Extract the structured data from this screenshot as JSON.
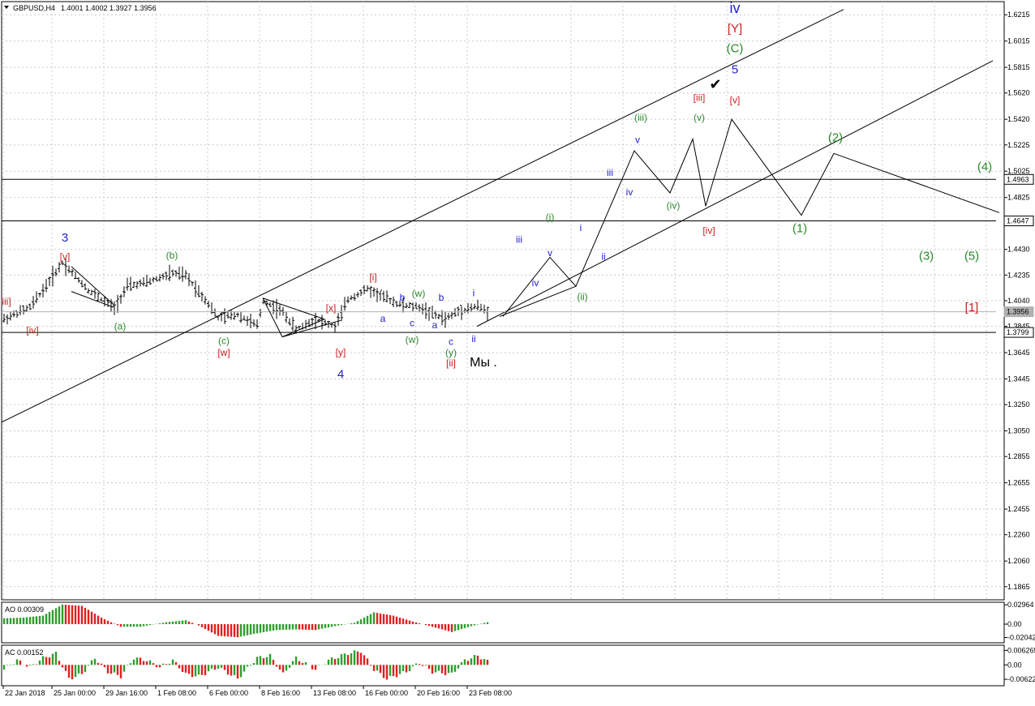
{
  "header": {
    "symbol": "GBPUSD,H4",
    "quote": "1.4001 1.4002 1.3927 1.3956"
  },
  "chart_data": {
    "type": "ohlc",
    "symbol": "GBPUSD",
    "timeframe": "H4",
    "price_axis": {
      "ylim": [
        1.1765,
        1.6315
      ],
      "ticks": [
        "1.6215",
        "1.6015",
        "1.5815",
        "1.5620",
        "1.5420",
        "1.5225",
        "1.5025",
        "1.4825",
        "1.4430",
        "1.4235",
        "1.4040",
        "1.3845",
        "1.3645",
        "1.3445",
        "1.3250",
        "1.3050",
        "1.2855",
        "1.2655",
        "1.2455",
        "1.2260",
        "1.2060",
        "1.1865"
      ],
      "tick_values": [
        1.6215,
        1.6015,
        1.5815,
        1.562,
        1.542,
        1.5225,
        1.5025,
        1.4825,
        1.443,
        1.4235,
        1.404,
        1.3845,
        1.3645,
        1.3445,
        1.325,
        1.305,
        1.2855,
        1.2655,
        1.2455,
        1.226,
        1.206,
        1.1865
      ],
      "price_labels": [
        {
          "text": "1.4963",
          "value": 1.4963,
          "style": "box"
        },
        {
          "text": "1.4647",
          "value": 1.4647,
          "style": "box"
        },
        {
          "text": "1.3956",
          "value": 1.3956,
          "style": "current"
        },
        {
          "text": "1.3799",
          "value": 1.3799,
          "style": "box"
        }
      ]
    },
    "time_axis": {
      "labels": [
        "22 Jan 2018",
        "25 Jan 00:00",
        "29 Jan 16:00",
        "1 Feb 08:00",
        "6 Feb 00:00",
        "8 Feb 16:00",
        "13 Feb 08:00",
        "16 Feb 00:00",
        "20 Feb 16:00",
        "23 Feb 08:00"
      ],
      "bar_index": [
        0,
        15,
        31,
        47,
        63,
        79,
        95,
        111,
        127,
        143
      ]
    },
    "grid": true,
    "bar_count": 150,
    "bar_pivots": [
      [
        0,
        1.39
      ],
      [
        8,
        1.399
      ],
      [
        12,
        1.412
      ],
      [
        18,
        1.433
      ],
      [
        20,
        1.428
      ],
      [
        26,
        1.412
      ],
      [
        34,
        1.3985
      ],
      [
        38,
        1.415
      ],
      [
        44,
        1.418
      ],
      [
        52,
        1.425
      ],
      [
        56,
        1.423
      ],
      [
        62,
        1.405
      ],
      [
        66,
        1.391
      ],
      [
        72,
        1.3935
      ],
      [
        78,
        1.385
      ],
      [
        80,
        1.404
      ],
      [
        86,
        1.395
      ],
      [
        90,
        1.382
      ],
      [
        96,
        1.39
      ],
      [
        102,
        1.384
      ],
      [
        106,
        1.405
      ],
      [
        112,
        1.413
      ],
      [
        116,
        1.408
      ],
      [
        122,
        1.401
      ],
      [
        128,
        1.399
      ],
      [
        132,
        1.394
      ],
      [
        136,
        1.39
      ],
      [
        140,
        1.396
      ],
      [
        146,
        1.4
      ],
      [
        149,
        1.3956
      ]
    ],
    "lines": [
      {
        "name": "channel-upper",
        "points": [
          [
            -1.0,
            1.311
          ],
          [
            259.0,
            1.6255
          ]
        ]
      },
      {
        "name": "channel-lower",
        "points": [
          [
            146.0,
            1.3845
          ],
          [
            305.0,
            1.5865
          ]
        ]
      },
      {
        "name": "level-1.4963",
        "points": [
          [
            -1.0,
            1.4963
          ],
          [
            306.0,
            1.4963
          ]
        ]
      },
      {
        "name": "level-1.4647",
        "points": [
          [
            -1.0,
            1.4647
          ],
          [
            306.0,
            1.4647
          ]
        ]
      },
      {
        "name": "level-1.3799",
        "points": [
          [
            -1.0,
            1.3799
          ],
          [
            306.0,
            1.3799
          ]
        ]
      },
      {
        "name": "level-1.3956",
        "points": [
          [
            -1.0,
            1.3956
          ],
          [
            306.0,
            1.3956
          ]
        ],
        "color": "#b0b0b0"
      },
      {
        "name": "forecast-path",
        "points": [
          [
            154.0,
            1.392
          ],
          [
            168.5,
            1.437
          ],
          [
            176.5,
            1.415
          ],
          [
            194.5,
            1.518
          ],
          [
            205.5,
            1.486
          ],
          [
            212.5,
            1.527
          ],
          [
            216.5,
            1.476
          ],
          [
            224.5,
            1.542
          ],
          [
            246.0,
            1.469
          ],
          [
            256.0,
            1.516
          ],
          [
            307.0,
            1.471
          ]
        ]
      },
      {
        "name": "forecast-low-leg",
        "points": [
          [
            153.0,
            1.392
          ],
          [
            176.5,
            1.415
          ]
        ]
      },
      {
        "name": "wedge-1a",
        "points": [
          [
            21.0,
            1.411
          ],
          [
            34.0,
            1.399
          ]
        ]
      },
      {
        "name": "wedge-1b",
        "points": [
          [
            21.0,
            1.43
          ],
          [
            34.0,
            1.401
          ]
        ]
      },
      {
        "name": "triangle-a",
        "points": [
          [
            80.0,
            1.406
          ],
          [
            99.0,
            1.39
          ]
        ]
      },
      {
        "name": "triangle-b",
        "points": [
          [
            86.0,
            1.3765
          ],
          [
            104.0,
            1.389
          ]
        ]
      },
      {
        "name": "triangle-c",
        "points": [
          [
            86.0,
            1.3765
          ],
          [
            99.0,
            1.39
          ]
        ]
      },
      {
        "name": "triangle-d",
        "points": [
          [
            80.0,
            1.406
          ],
          [
            86.0,
            1.3765
          ]
        ]
      }
    ],
    "annotations": [
      {
        "text": "3",
        "x": 19.0,
        "y": 1.449,
        "color": "#1f1fcf",
        "size": 15
      },
      {
        "text": "[v]",
        "x": 19.0,
        "y": 1.435,
        "color": "#cc2020",
        "size": 12
      },
      {
        "text": "iii]",
        "x": 1.0,
        "y": 1.401,
        "color": "#cc2020",
        "size": 12
      },
      {
        "text": "[iv]",
        "x": 9.0,
        "y": 1.379,
        "color": "#cc2020",
        "size": 12
      },
      {
        "text": "(a)",
        "x": 36.0,
        "y": 1.382,
        "color": "#2a8a2a",
        "size": 12
      },
      {
        "text": "(b)",
        "x": 52.0,
        "y": 1.436,
        "color": "#2a8a2a",
        "size": 12
      },
      {
        "text": "(c)",
        "x": 68.0,
        "y": 1.371,
        "color": "#2a8a2a",
        "size": 12
      },
      {
        "text": "[w]",
        "x": 68.0,
        "y": 1.362,
        "color": "#cc2020",
        "size": 12
      },
      {
        "text": "[x]",
        "x": 101.0,
        "y": 1.396,
        "color": "#cc2020",
        "size": 12
      },
      {
        "text": "[y]",
        "x": 104.0,
        "y": 1.3625,
        "color": "#cc2020",
        "size": 12
      },
      {
        "text": "4",
        "x": 104.0,
        "y": 1.345,
        "color": "#1f1fcf",
        "size": 15
      },
      {
        "text": "[i]",
        "x": 114.0,
        "y": 1.4195,
        "color": "#cc2020",
        "size": 12
      },
      {
        "text": "a",
        "x": 117.0,
        "y": 1.388,
        "color": "#1f1fcf",
        "size": 12
      },
      {
        "text": "b",
        "x": 123.0,
        "y": 1.404,
        "color": "#1f1fcf",
        "size": 12
      },
      {
        "text": "c",
        "x": 126.0,
        "y": 1.3845,
        "color": "#1f1fcf",
        "size": 12
      },
      {
        "text": "(w)",
        "x": 128.0,
        "y": 1.407,
        "color": "#2a8a2a",
        "size": 12
      },
      {
        "text": "(w)",
        "x": 126.0,
        "y": 1.372,
        "color": "#2a8a2a",
        "size": 12
      },
      {
        "text": "a",
        "x": 133.0,
        "y": 1.383,
        "color": "#1f1fcf",
        "size": 12
      },
      {
        "text": "b",
        "x": 135.0,
        "y": 1.404,
        "color": "#1f1fcf",
        "size": 12
      },
      {
        "text": "c",
        "x": 138.0,
        "y": 1.3705,
        "color": "#1f1fcf",
        "size": 12
      },
      {
        "text": "(y)",
        "x": 138.0,
        "y": 1.362,
        "color": "#2a8a2a",
        "size": 12
      },
      {
        "text": "[ii]",
        "x": 138.0,
        "y": 1.354,
        "color": "#cc2020",
        "size": 12
      },
      {
        "text": "i",
        "x": 145.0,
        "y": 1.4075,
        "color": "#1f1fcf",
        "size": 12
      },
      {
        "text": "ii",
        "x": 145.0,
        "y": 1.3725,
        "color": "#1f1fcf",
        "size": 12
      },
      {
        "text": "Мы .",
        "x": 148.0,
        "y": 1.354,
        "color": "#000000",
        "size": 16
      },
      {
        "text": "iii",
        "x": 159.0,
        "y": 1.448,
        "color": "#1f1fcf",
        "size": 12
      },
      {
        "text": "iv",
        "x": 164.0,
        "y": 1.415,
        "color": "#1f1fcf",
        "size": 12
      },
      {
        "text": "(i)",
        "x": 168.5,
        "y": 1.465,
        "color": "#2a8a2a",
        "size": 12
      },
      {
        "text": "v",
        "x": 168.5,
        "y": 1.438,
        "color": "#1f1fcf",
        "size": 12
      },
      {
        "text": "(ii)",
        "x": 178.5,
        "y": 1.4045,
        "color": "#2a8a2a",
        "size": 12
      },
      {
        "text": "i",
        "x": 178.0,
        "y": 1.457,
        "color": "#1f1fcf",
        "size": 12
      },
      {
        "text": "ii",
        "x": 185.0,
        "y": 1.435,
        "color": "#1f1fcf",
        "size": 12
      },
      {
        "text": "iii",
        "x": 187.0,
        "y": 1.499,
        "color": "#1f1fcf",
        "size": 12
      },
      {
        "text": "iv",
        "x": 193.0,
        "y": 1.484,
        "color": "#1f1fcf",
        "size": 12
      },
      {
        "text": "v",
        "x": 195.5,
        "y": 1.524,
        "color": "#1f1fcf",
        "size": 12
      },
      {
        "text": "(iii)",
        "x": 196.5,
        "y": 1.541,
        "color": "#2a8a2a",
        "size": 12
      },
      {
        "text": "(iv)",
        "x": 206.5,
        "y": 1.474,
        "color": "#2a8a2a",
        "size": 12
      },
      {
        "text": "(v)",
        "x": 214.5,
        "y": 1.541,
        "color": "#2a8a2a",
        "size": 12
      },
      {
        "text": "[iii]",
        "x": 214.5,
        "y": 1.556,
        "color": "#cc2020",
        "size": 12
      },
      {
        "text": "[iv]",
        "x": 217.5,
        "y": 1.455,
        "color": "#cc2020",
        "size": 12
      },
      {
        "text": "[v]",
        "x": 225.5,
        "y": 1.554,
        "color": "#cc2020",
        "size": 12
      },
      {
        "text": "✔",
        "x": 219.5,
        "y": 1.565,
        "color": "#000000",
        "size": 18
      },
      {
        "text": "5",
        "x": 225.5,
        "y": 1.577,
        "color": "#1f1fcf",
        "size": 15
      },
      {
        "text": "(C)",
        "x": 225.5,
        "y": 1.593,
        "color": "#2a8a2a",
        "size": 15
      },
      {
        "text": "[Y]",
        "x": 225.5,
        "y": 1.608,
        "color": "#cc2020",
        "size": 15
      },
      {
        "text": "iv",
        "x": 225.5,
        "y": 1.623,
        "color": "#1f1fcf",
        "size": 18
      },
      {
        "text": "(1)",
        "x": 245.5,
        "y": 1.456,
        "color": "#2a8a2a",
        "size": 15
      },
      {
        "text": "(2)",
        "x": 256.5,
        "y": 1.525,
        "color": "#2a8a2a",
        "size": 15
      },
      {
        "text": "(3)",
        "x": 284.5,
        "y": 1.435,
        "color": "#2a8a2a",
        "size": 15
      },
      {
        "text": "(4)",
        "x": 302.5,
        "y": 1.503,
        "color": "#2a8a2a",
        "size": 15
      },
      {
        "text": "(5)",
        "x": 298.5,
        "y": 1.435,
        "color": "#2a8a2a",
        "size": 15
      },
      {
        "text": "[1]",
        "x": 298.5,
        "y": 1.396,
        "color": "#cc2020",
        "size": 15
      }
    ],
    "indicators": [
      {
        "name": "AO",
        "label": "AO 0.00309",
        "ylim": [
          -0.0285,
          0.0335
        ],
        "ticks": [
          "0.02964",
          "0.00",
          "-0.02042"
        ],
        "tick_values": [
          0.02964,
          0.0,
          -0.02042
        ],
        "pivots": [
          [
            0,
            0.009
          ],
          [
            6,
            0.01
          ],
          [
            12,
            0.013
          ],
          [
            18,
            0.03
          ],
          [
            24,
            0.028
          ],
          [
            30,
            0.01
          ],
          [
            36,
            -0.004
          ],
          [
            42,
            -0.004
          ],
          [
            50,
            0.003
          ],
          [
            56,
            0.006
          ],
          [
            60,
            -0.002
          ],
          [
            66,
            -0.018
          ],
          [
            72,
            -0.02
          ],
          [
            78,
            -0.014
          ],
          [
            84,
            -0.009
          ],
          [
            90,
            -0.008
          ],
          [
            96,
            -0.009
          ],
          [
            102,
            -0.003
          ],
          [
            108,
            0.002
          ],
          [
            114,
            0.018
          ],
          [
            120,
            0.013
          ],
          [
            126,
            0.004
          ],
          [
            132,
            -0.004
          ],
          [
            138,
            -0.012
          ],
          [
            144,
            -0.003
          ],
          [
            149,
            0.003
          ]
        ]
      },
      {
        "name": "AC",
        "label": "AC 0.00152",
        "ylim": [
          -0.009,
          0.0085
        ],
        "ticks": [
          "0.006265",
          "0.00",
          "-0.006225"
        ],
        "tick_values": [
          0.006265,
          0.0,
          -0.006225
        ],
        "pivots": [
          [
            0,
            -0.002
          ],
          [
            4,
            0.002
          ],
          [
            8,
            -0.001
          ],
          [
            12,
            0.003
          ],
          [
            16,
            0.005
          ],
          [
            20,
            -0.006
          ],
          [
            24,
            -0.004
          ],
          [
            28,
            0.003
          ],
          [
            32,
            -0.003
          ],
          [
            36,
            -0.005
          ],
          [
            40,
            0.003
          ],
          [
            44,
            0.002
          ],
          [
            48,
            -0.001
          ],
          [
            52,
            0.002
          ],
          [
            56,
            -0.004
          ],
          [
            60,
            -0.005
          ],
          [
            66,
            -0.001
          ],
          [
            72,
            -0.006
          ],
          [
            78,
            0.003
          ],
          [
            82,
            0.004
          ],
          [
            86,
            -0.004
          ],
          [
            90,
            0.003
          ],
          [
            96,
            -0.002
          ],
          [
            100,
            0.002
          ],
          [
            106,
            0.005
          ],
          [
            110,
            0.006
          ],
          [
            114,
            -0.002
          ],
          [
            118,
            -0.006
          ],
          [
            124,
            -0.003
          ],
          [
            128,
            0.001
          ],
          [
            132,
            -0.003
          ],
          [
            138,
            -0.004
          ],
          [
            142,
            0.002
          ],
          [
            146,
            0.004
          ],
          [
            149,
            0.0015
          ]
        ]
      }
    ]
  },
  "colors": {
    "up": "#2e9e2e",
    "down": "#e02020",
    "grid": "#c8c8d8",
    "bars": "#000000",
    "current": "#b0b0b0"
  }
}
